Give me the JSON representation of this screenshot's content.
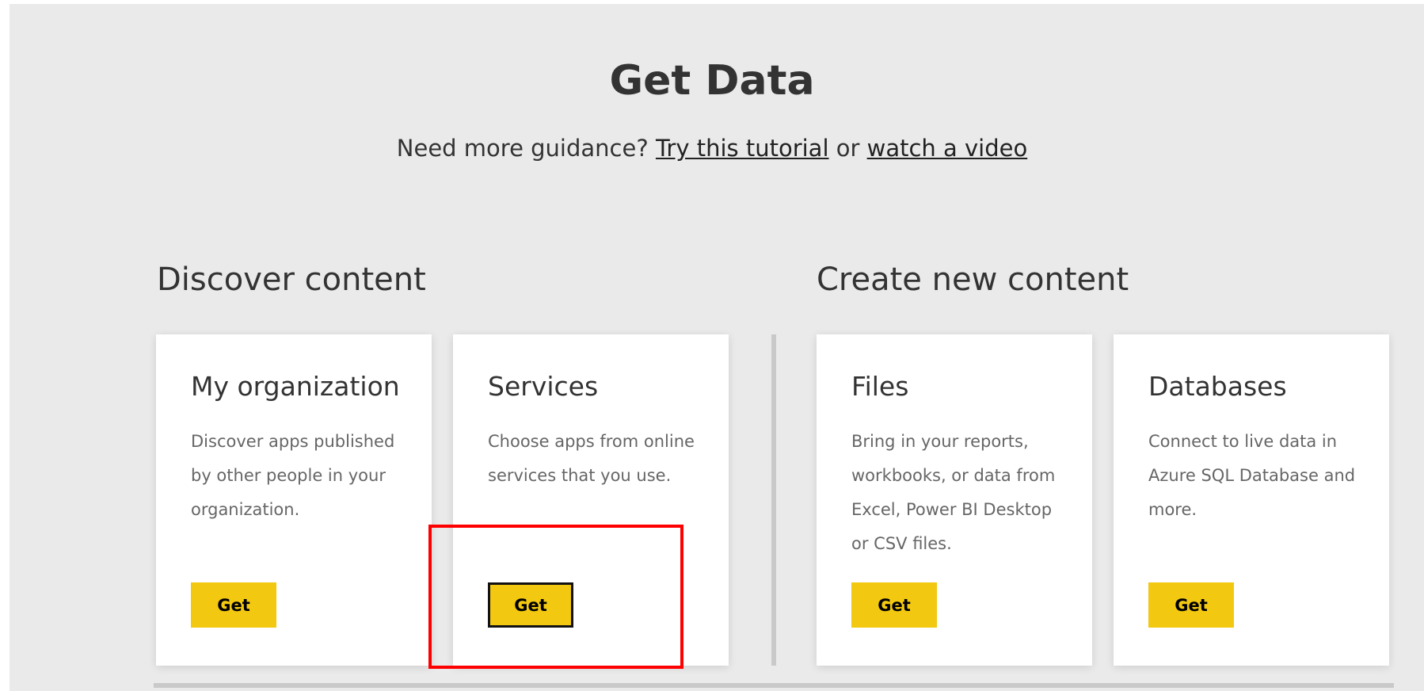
{
  "header": {
    "title": "Get Data",
    "guidance_prefix": "Need more guidance?",
    "tutorial_link": "Try this tutorial",
    "or_text": "or",
    "video_link": "watch a video"
  },
  "sections": {
    "discover": {
      "title": "Discover content"
    },
    "create": {
      "title": "Create new content"
    }
  },
  "cards": [
    {
      "title": "My organization",
      "description": "Discover apps published by other people in your organization.",
      "button": "Get"
    },
    {
      "title": "Services",
      "description": "Choose apps from online services that you use.",
      "button": "Get"
    },
    {
      "title": "Files",
      "description": "Bring in your reports, workbooks, or data from Excel, Power BI Desktop or CSV files.",
      "button": "Get"
    },
    {
      "title": "Databases",
      "description": "Connect to live data in Azure SQL Database and more.",
      "button": "Get"
    }
  ],
  "colors": {
    "button": "#f2c811",
    "background": "#eaeaea",
    "highlight": "#ff0000"
  }
}
